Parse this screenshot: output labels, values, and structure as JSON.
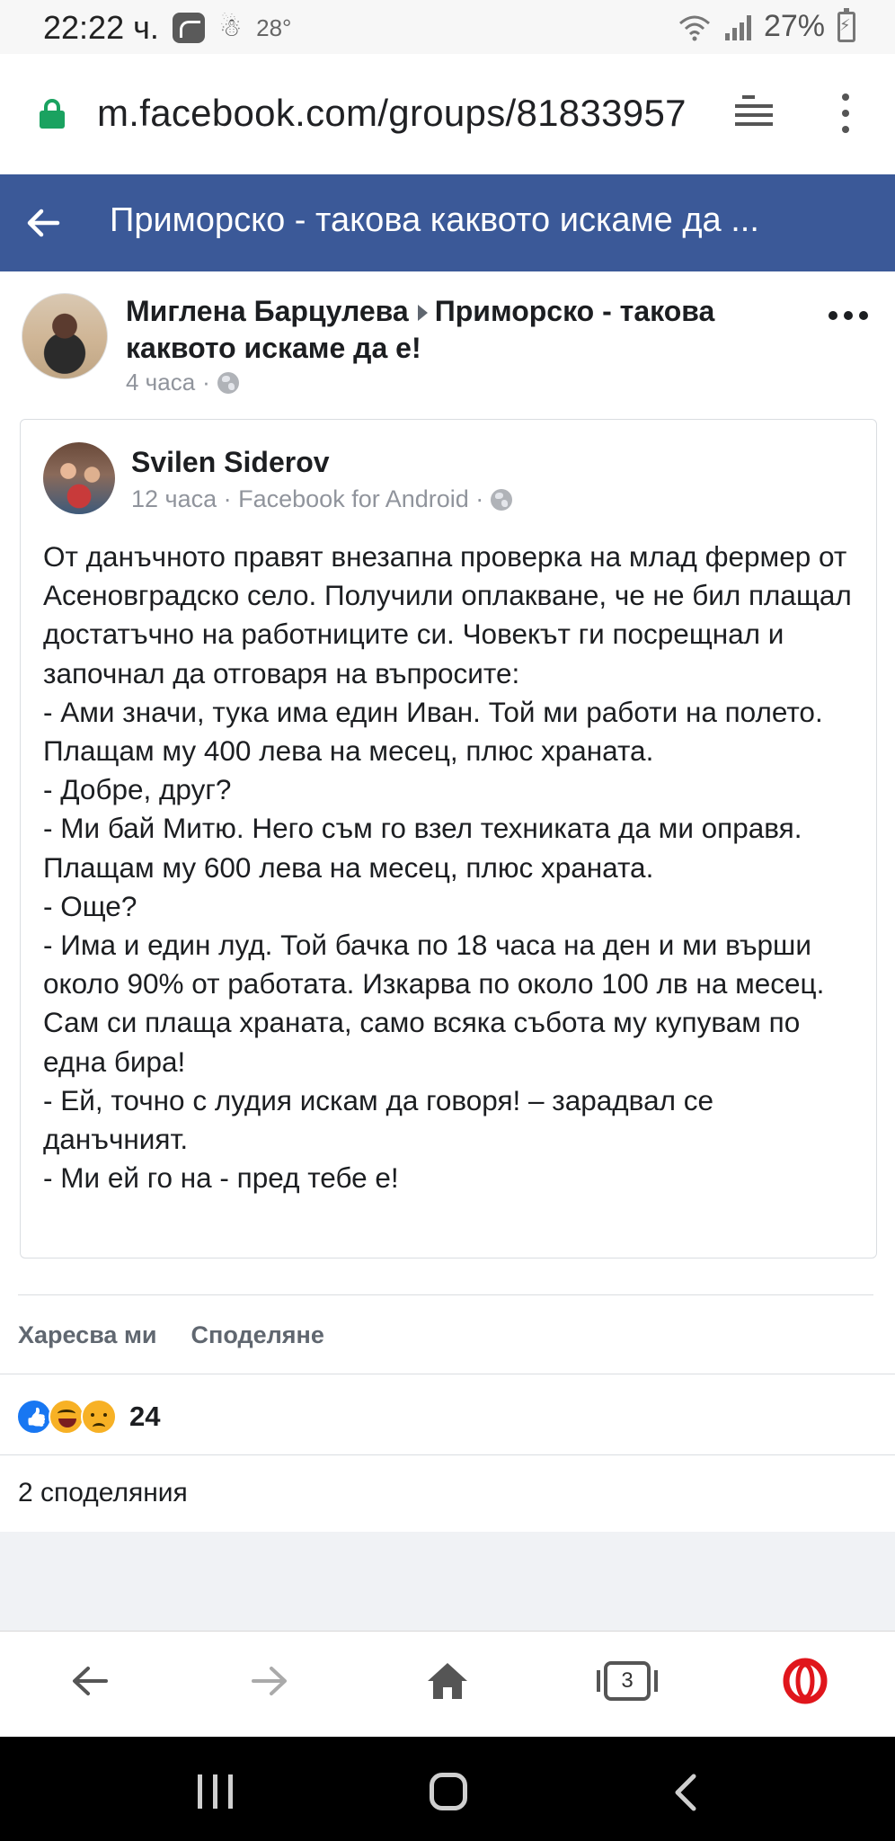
{
  "status_bar": {
    "time": "22:22 ч.",
    "temperature": "28°",
    "battery": "27%"
  },
  "url_bar": {
    "url": "m.facebook.com/groups/81833957"
  },
  "header": {
    "title": "Приморско - такова каквото искаме да ..."
  },
  "post": {
    "author": "Миглена Барцулева",
    "group": "Приморско - такова каквото искаме да е!",
    "time": "4 часа",
    "meta_separator": "·"
  },
  "shared": {
    "author": "Svilen Siderov",
    "meta": "12 часа · Facebook for Android ·",
    "body": "От данъчното правят внезапна проверка на млад фермер от Асеновградско село. Получили оплакване, че не бил плащал достатъчно на работниците си. Човекът ги посрещнал и започнал да отговаря на въпросите:\n- Ами значи, тука има един Иван. Той ми работи на полето. Плащам му 400 лева на месец, плюс храната.\n- Добре, друг?\n- Ми бай Митю. Него съм го взел техниката да ми оправя. Плащам му 600 лева на месец, плюс храната.\n- Още?\n- Има и един луд. Той бачка по 18 часа на ден и ми върши около 90% от работата. Изкарва по около 100 лв на месец. Сам си плаща храната, само всяка събота му купувам по една бира!\n- Ей, точно с лудия искам да говоря! – зарадвал се данъчният.\n- Ми ей го на - пред тебе е!"
  },
  "actions": {
    "like": "Харесва ми",
    "share": "Споделяне"
  },
  "reactions": {
    "icons": [
      "like-icon",
      "haha-icon",
      "sad-icon"
    ],
    "count": "24"
  },
  "shares": "2 споделяния",
  "browser_toolbar": {
    "tab_count": "3"
  },
  "colors": {
    "facebook_blue": "#3b5998",
    "lock_green": "#1aa260",
    "opera_red": "#e0161c"
  }
}
